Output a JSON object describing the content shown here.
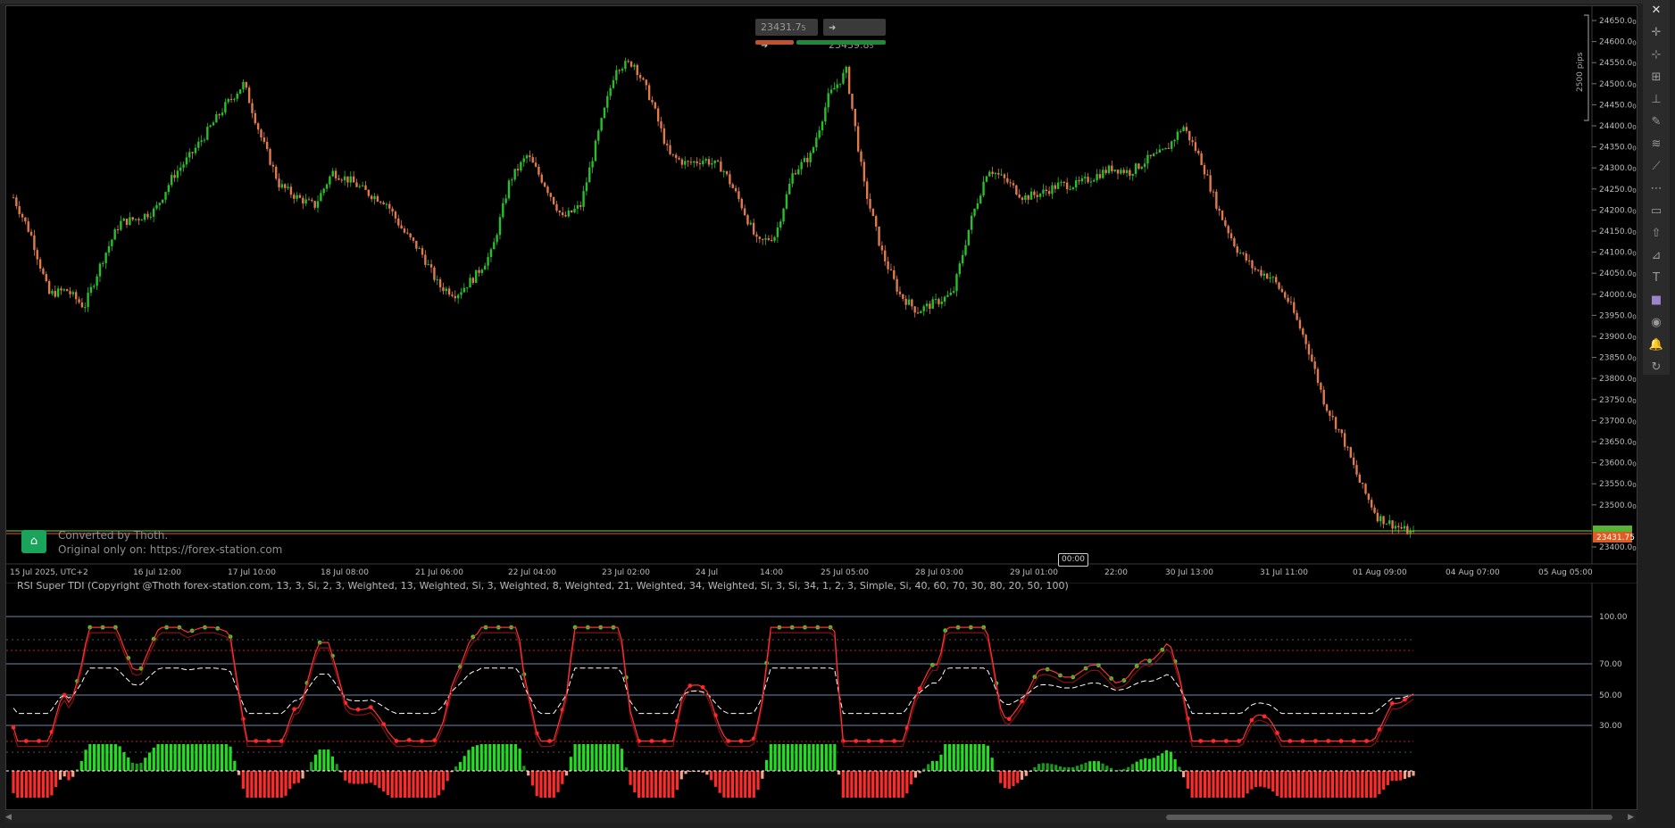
{
  "quotes": {
    "sell_value": "23431.7",
    "sell_sub": "5",
    "buy_value": "23439.8",
    "buy_sub": "5",
    "sell_icon": "arrow-right-icon",
    "buy_icon": "arrow-right-icon"
  },
  "price_axis": {
    "labels": [
      "24650.0",
      "24600.0",
      "24550.0",
      "24500.0",
      "24450.0",
      "24400.0",
      "24350.0",
      "24300.0",
      "24250.0",
      "24200.0",
      "24150.0",
      "24100.0",
      "24050.0",
      "24000.0",
      "23950.0",
      "23900.0",
      "23850.0",
      "23800.0",
      "23750.0",
      "23700.0",
      "23650.0",
      "23600.0",
      "23550.0",
      "23500.0",
      "23400.0"
    ],
    "subscript": "0",
    "current_price": "23431.75",
    "range_label": "2500 pips",
    "bid_color": "#e05a23",
    "ask_color": "#7cd14a"
  },
  "time_axis": {
    "labels": [
      "15 Jul 2025, UTC+2",
      "16 Jul 12:00",
      "17 Jul 10:00",
      "18 Jul 08:00",
      "21 Jul 06:00",
      "22 Jul 04:00",
      "23 Jul 02:00",
      "24 Jul",
      "14:00",
      "25 Jul 05:00",
      "28 Jul 03:00",
      "29 Jul 01:00",
      "22:00",
      "30 Jul 13:00",
      "31 Jul 11:00",
      "01 Aug 09:00",
      "04 Aug 07:00",
      "05 Aug 05:00"
    ],
    "cursor_label": "00:00"
  },
  "watermark": {
    "line1": "Converted by Thoth.",
    "line2": "Original only on: https://forex-station.com"
  },
  "indicator": {
    "title": "RSI Super TDI (Copyright @Thoth forex-station.com, 13, 3, Si, 2, 3, Weighted, 13, Weighted, Si, 3, Weighted, 8, Weighted, 21, Weighted, 34, Weighted, Si, 3, Si, 34, 1, 2, 3, Simple, Si, 40, 60, 70, 30, 80, 20, 50, 100)",
    "levels": [
      "100.00",
      "70.00",
      "50.00",
      "30.00"
    ]
  },
  "chart_data": {
    "type": "candlestick",
    "series_trend_close": [
      24230,
      24140,
      24000,
      24010,
      23970,
      24080,
      24170,
      24180,
      24200,
      24280,
      24330,
      24390,
      24450,
      24500,
      24370,
      24260,
      24230,
      24210,
      24290,
      24270,
      24240,
      24220,
      24150,
      24100,
      24020,
      24000,
      24040,
      24100,
      24270,
      24330,
      24260,
      24180,
      24210,
      24380,
      24540,
      24550,
      24460,
      24330,
      24310,
      24320,
      24300,
      24220,
      24120,
      24140,
      24290,
      24330,
      24470,
      24530,
      24260,
      24100,
      24000,
      23960,
      23980,
      24000,
      24170,
      24300,
      24270,
      24230,
      24240,
      24260,
      24260,
      24280,
      24300,
      24290,
      24320,
      24340,
      24400,
      24320,
      24200,
      24110,
      24060,
      24040,
      23980,
      23880,
      23740,
      23660,
      23550,
      23470,
      23450,
      23430
    ],
    "ylim": [
      23400,
      24650
    ],
    "indicator_levels": [
      100,
      70,
      50,
      30
    ],
    "bull_color": "#27c02a",
    "bear_color": "#e07a4a"
  },
  "toolbar": {
    "icons": [
      "close-icon",
      "crosshair-icon",
      "cursor-icon",
      "add-line-icon",
      "horizontal-line-icon",
      "pencil-icon",
      "fibonacci-icon",
      "trendline-icon",
      "rectangle-dotted-icon",
      "rectangle-icon",
      "arrow-up-icon",
      "measure-icon",
      "text-icon",
      "color-swatch-icon",
      "camera-icon",
      "alert-icon",
      "replay-icon"
    ],
    "glyphs": [
      "✕",
      "✛",
      "⊹",
      "⊞",
      "⊥",
      "✎",
      "≋",
      "⟋",
      "⋯",
      "▭",
      "⇧",
      "⊿",
      "T",
      "■",
      "◉",
      "🔔",
      "↻"
    ]
  }
}
